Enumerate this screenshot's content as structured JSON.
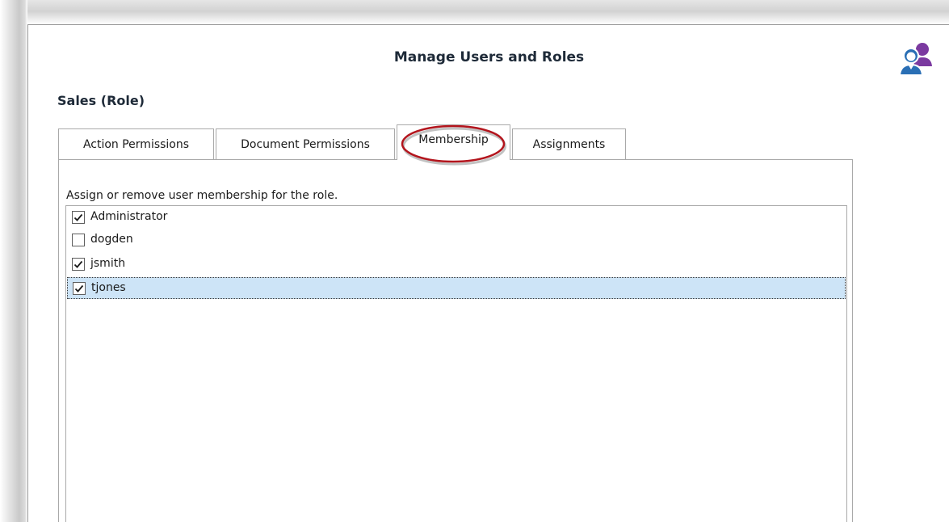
{
  "window": {
    "title": "Manage Users and Roles",
    "role_title": "Sales (Role)",
    "icon": "users-roles-icon"
  },
  "tabs": [
    {
      "label": "Action Permissions",
      "active": false
    },
    {
      "label": "Document Permissions",
      "active": false
    },
    {
      "label": "Membership",
      "active": true
    },
    {
      "label": "Assignments",
      "active": false
    }
  ],
  "membership": {
    "instructions": "Assign or remove user membership for the role.",
    "members": [
      {
        "name": "Administrator",
        "checked": true,
        "selected": false
      },
      {
        "name": "dogden",
        "checked": false,
        "selected": false
      },
      {
        "name": "jsmith",
        "checked": true,
        "selected": false
      },
      {
        "name": "tjones",
        "checked": true,
        "selected": true
      }
    ]
  },
  "colors": {
    "highlight_ellipse": "#b3151d",
    "selected_row": "#cde4f7",
    "icon_blue": "#2a6fb5",
    "icon_purple": "#7b3aa0"
  }
}
